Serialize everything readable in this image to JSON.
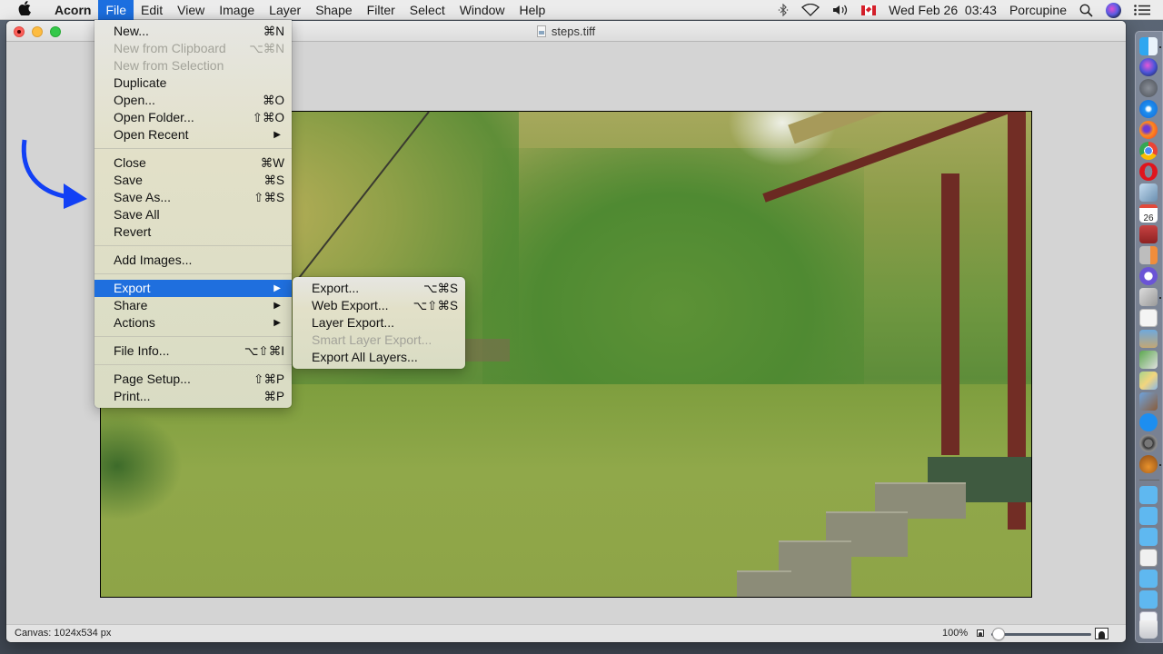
{
  "menubar": {
    "apple_icon": "apple-logo-icon",
    "app_name": "Acorn",
    "menus": [
      "File",
      "Edit",
      "View",
      "Image",
      "Layer",
      "Shape",
      "Filter",
      "Select",
      "Window",
      "Help"
    ],
    "active_menu": "File",
    "status": {
      "bluetooth_icon": "bluetooth-icon",
      "wifi_icon": "wifi-icon",
      "volume_icon": "volume-icon",
      "input_source_icon": "canada-flag-icon",
      "datetime": "Wed Feb 26  03:43",
      "user": "Porcupine",
      "spotlight_icon": "search-icon",
      "siri_icon": "siri-icon",
      "notification_icon": "list-icon"
    }
  },
  "window": {
    "title": "steps.tiff",
    "status": {
      "canvas_info": "Canvas: 1024x534 px",
      "zoom_percent": "100%",
      "zoom_slider_value": 0.0
    }
  },
  "file_menu": {
    "items": [
      {
        "label": "New...",
        "shortcut": "⌘N",
        "enabled": true
      },
      {
        "label": "New from Clipboard",
        "shortcut": "⌥⌘N",
        "enabled": false
      },
      {
        "label": "New from Selection",
        "shortcut": "",
        "enabled": false
      },
      {
        "label": "Duplicate",
        "shortcut": "",
        "enabled": true
      },
      {
        "label": "Open...",
        "shortcut": "⌘O",
        "enabled": true
      },
      {
        "label": "Open Folder...",
        "shortcut": "⇧⌘O",
        "enabled": true
      },
      {
        "label": "Open Recent",
        "shortcut": "▶",
        "enabled": true
      },
      {
        "label": "Close",
        "shortcut": "⌘W",
        "enabled": true
      },
      {
        "label": "Save",
        "shortcut": "⌘S",
        "enabled": true
      },
      {
        "label": "Save As...",
        "shortcut": "⇧⌘S",
        "enabled": true
      },
      {
        "label": "Save All",
        "shortcut": "",
        "enabled": true
      },
      {
        "label": "Revert",
        "shortcut": "",
        "enabled": true
      },
      {
        "label": "Add Images...",
        "shortcut": "",
        "enabled": true
      },
      {
        "label": "Export",
        "shortcut": "▶",
        "enabled": true,
        "highlighted": true
      },
      {
        "label": "Share",
        "shortcut": "▶",
        "enabled": true
      },
      {
        "label": "Actions",
        "shortcut": "▶",
        "enabled": true
      },
      {
        "label": "File Info...",
        "shortcut": "⌥⇧⌘I",
        "enabled": true
      },
      {
        "label": "Page Setup...",
        "shortcut": "⇧⌘P",
        "enabled": true
      },
      {
        "label": "Print...",
        "shortcut": "⌘P",
        "enabled": true
      }
    ]
  },
  "export_submenu": {
    "items": [
      {
        "label": "Export...",
        "shortcut": "⌥⌘S",
        "enabled": true
      },
      {
        "label": "Web Export...",
        "shortcut": "⌥⇧⌘S",
        "enabled": true
      },
      {
        "label": "Layer Export...",
        "shortcut": "",
        "enabled": true
      },
      {
        "label": "Smart Layer Export...",
        "shortcut": "",
        "enabled": false
      },
      {
        "label": "Export All Layers...",
        "shortcut": "",
        "enabled": true
      }
    ]
  },
  "annotation": {
    "type": "curved-arrow",
    "color": "#1240f5",
    "points_to": "Save As..."
  },
  "dock": {
    "apps": [
      "Finder",
      "Siri",
      "Launchpad",
      "Safari",
      "Firefox",
      "Chrome",
      "Opera",
      "Preview",
      "Calendar",
      "Dictionary",
      "Calculator",
      "BBEdit",
      "Script Editor",
      "TextEdit",
      "Image Capture",
      "Preview Editor",
      "Maps",
      "Photos",
      "App Store",
      "System Preferences",
      "Acorn"
    ],
    "calendar_day": "26",
    "folders": [
      "Folder",
      "Folder",
      "Folder",
      "Document",
      "Folder",
      "Folder",
      "Screenshot"
    ],
    "trash": "Trash"
  },
  "colors": {
    "highlight": "#1f6fde",
    "menubar_active": "#1c6fe0",
    "annotation": "#1240f5"
  }
}
